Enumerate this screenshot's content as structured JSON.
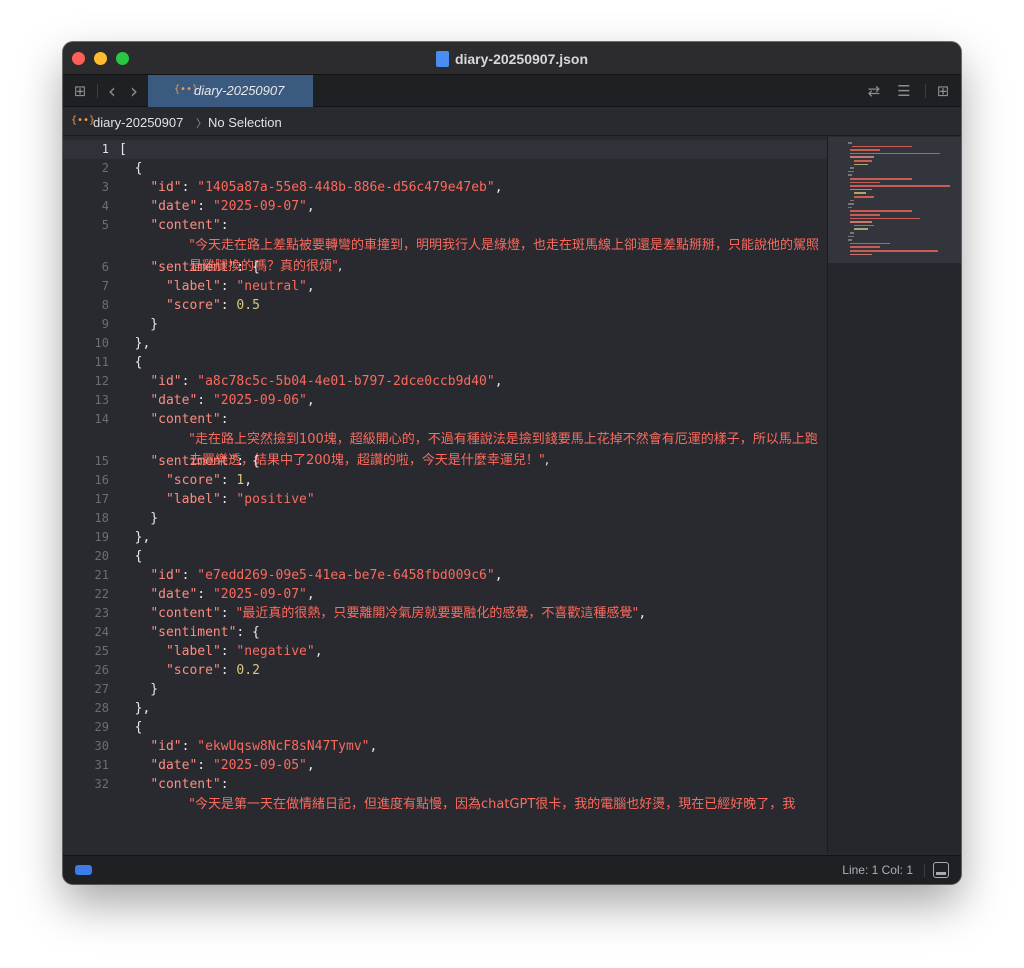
{
  "window": {
    "title": "diary-20250907.json"
  },
  "tabbar": {
    "grid_icon": "⊞",
    "back_icon": "‹",
    "forward_icon": "›",
    "tab_glyph": "{••}",
    "tab_label": "diary-20250907",
    "swap_icon": "⇄",
    "editor_options_icon": "☰",
    "add_editor_icon": "⊞"
  },
  "jumpbar": {
    "glyph": "{••}",
    "file": "diary-20250907",
    "chevron": "〉",
    "selection": "No Selection"
  },
  "editor": {
    "line_numbers": [
      "1",
      "2",
      "3",
      "4",
      "5",
      "6",
      "7",
      "8",
      "9",
      "10",
      "11",
      "12",
      "13",
      "14",
      "15",
      "16",
      "17",
      "18",
      "19",
      "20",
      "21",
      "22",
      "23",
      "24",
      "25",
      "26",
      "27",
      "28",
      "29",
      "30",
      "31",
      "32"
    ],
    "current_line": "1",
    "entries": [
      {
        "id": "1405a87a-55e8-448b-886e-d56c479e47eb",
        "date": "2025-09-07",
        "content": "今天走在路上差點被要轉彎的車撞到，明明我行人是綠燈，也走在斑馬線上卻還是差點掰掰，只能說他的駕照是雞腿換的嗎？真的很煩",
        "sentiment_first_key": "label",
        "sentiment_first_value": "neutral",
        "sentiment_second_key": "score",
        "sentiment_second_value": "0.5"
      },
      {
        "id": "a8c78c5c-5b04-4e01-b797-2dce0ccb9d40",
        "date": "2025-09-06",
        "content": "走在路上突然撿到100塊，超級開心的，不過有種說法是撿到錢要馬上花掉不然會有厄運的樣子，所以馬上跑去買樂透，結果中了200塊，超讚的啦，今天是什麼幸運兒！",
        "sentiment_first_key": "score",
        "sentiment_first_value": "1",
        "sentiment_second_key": "label",
        "sentiment_second_value": "positive"
      },
      {
        "id": "e7edd269-09e5-41ea-be7e-6458fbd009c6",
        "date": "2025-09-07",
        "content": "最近真的很熱，只要離開冷氣房就要要融化的感覺，不喜歡這種感覺",
        "sentiment_first_key": "label",
        "sentiment_first_value": "negative",
        "sentiment_second_key": "score",
        "sentiment_second_value": "0.2"
      },
      {
        "id": "ekwUqsw8NcF8sN47Tymv",
        "date": "2025-09-05",
        "content": "今天是第一天在做情緒日記，但進度有點慢，因為chatGPT很卡，我的電腦也好燙，現在已經好晚了，我"
      }
    ]
  },
  "colors": {
    "key": "#fc8d7f",
    "string": "#fc6a5d",
    "number": "#d9c97c",
    "background": "#292a30"
  },
  "statusbar": {
    "position": "Line: 1  Col: 1"
  }
}
